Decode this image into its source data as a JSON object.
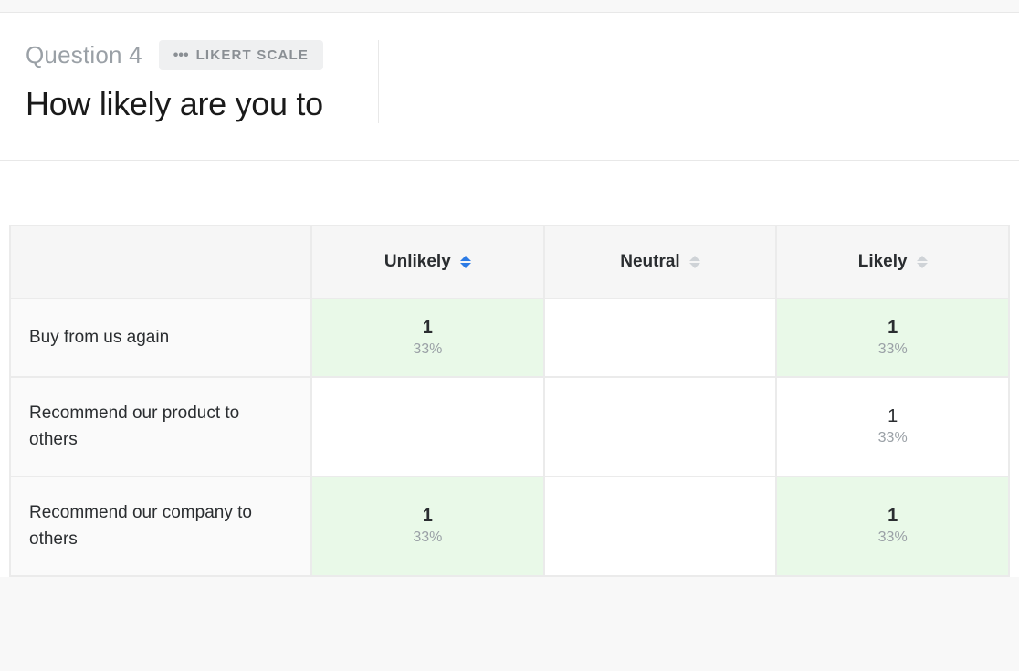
{
  "header": {
    "question_number": "Question 4",
    "type_label": "LIKERT SCALE",
    "title": "How likely are you to"
  },
  "table": {
    "columns": [
      {
        "label": "Unlikely",
        "active_sort": true
      },
      {
        "label": "Neutral",
        "active_sort": false
      },
      {
        "label": "Likely",
        "active_sort": false
      }
    ],
    "rows": [
      {
        "label": "Buy from us again",
        "cells": [
          {
            "count": "1",
            "pct": "33%",
            "highlight": true,
            "bold": true
          },
          {
            "count": "",
            "pct": "",
            "highlight": false,
            "bold": false
          },
          {
            "count": "1",
            "pct": "33%",
            "highlight": true,
            "bold": true
          }
        ]
      },
      {
        "label": "Recommend our product to others",
        "cells": [
          {
            "count": "",
            "pct": "",
            "highlight": false,
            "bold": false
          },
          {
            "count": "",
            "pct": "",
            "highlight": false,
            "bold": false
          },
          {
            "count": "1",
            "pct": "33%",
            "highlight": false,
            "bold": false
          }
        ]
      },
      {
        "label": "Recommend our company to others",
        "cells": [
          {
            "count": "1",
            "pct": "33%",
            "highlight": true,
            "bold": true
          },
          {
            "count": "",
            "pct": "",
            "highlight": false,
            "bold": false
          },
          {
            "count": "1",
            "pct": "33%",
            "highlight": true,
            "bold": true
          }
        ]
      }
    ]
  },
  "chart_data": {
    "type": "table",
    "title": "How likely are you to",
    "columns": [
      "Unlikely",
      "Neutral",
      "Likely"
    ],
    "rows": [
      "Buy from us again",
      "Recommend our product to others",
      "Recommend our company to others"
    ],
    "counts": [
      [
        1,
        null,
        1
      ],
      [
        null,
        null,
        1
      ],
      [
        1,
        null,
        1
      ]
    ],
    "percentages": [
      [
        33,
        null,
        33
      ],
      [
        null,
        null,
        33
      ],
      [
        33,
        null,
        33
      ]
    ]
  }
}
